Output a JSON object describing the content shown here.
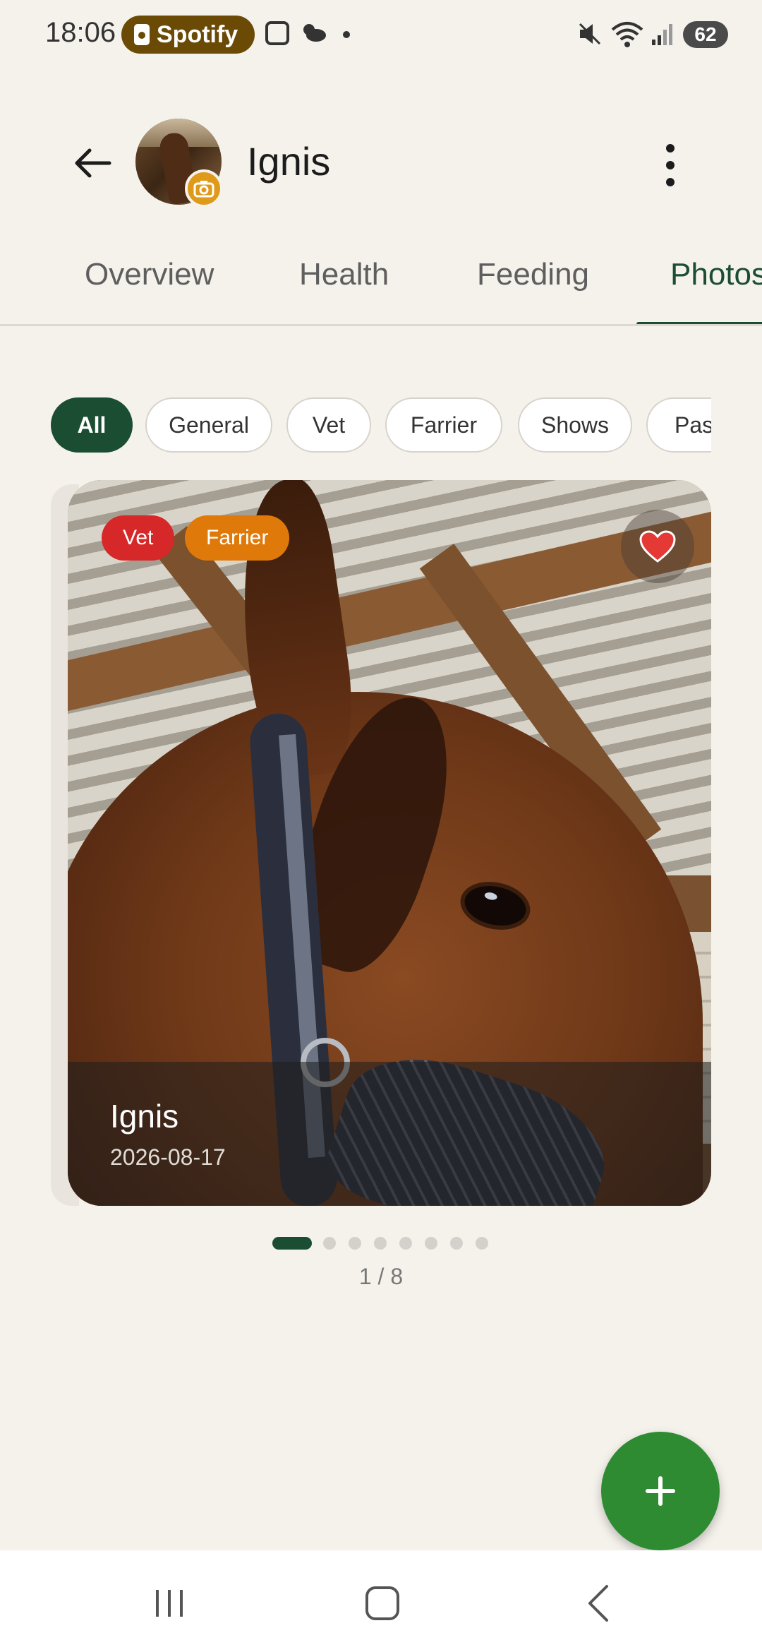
{
  "status_bar": {
    "time": "18:06",
    "media_app": "Spotify",
    "battery": "62",
    "icons": [
      "screenshot-icon",
      "weather-icon",
      "notification-dot-icon",
      "mute-icon",
      "wifi-icon",
      "signal-icon"
    ]
  },
  "header": {
    "title": "Ignis",
    "back_icon": "arrow-left-icon",
    "avatar_badge_icon": "camera-icon",
    "menu_icon": "more-vertical-icon"
  },
  "tabs": [
    {
      "label": "Overview",
      "active": false
    },
    {
      "label": "Health",
      "active": false
    },
    {
      "label": "Feeding",
      "active": false
    },
    {
      "label": "Photos",
      "active": true
    }
  ],
  "filters": [
    {
      "label": "All",
      "selected": true
    },
    {
      "label": "General",
      "selected": false
    },
    {
      "label": "Vet",
      "selected": false
    },
    {
      "label": "Farrier",
      "selected": false
    },
    {
      "label": "Shows",
      "selected": false
    },
    {
      "label": "Past",
      "selected": false
    }
  ],
  "photo": {
    "name": "Ignis",
    "date": "2026-08-17",
    "tags": [
      "Vet",
      "Farrier"
    ],
    "favorite": true
  },
  "pager": {
    "current": 1,
    "total": 8,
    "label": "1 / 8"
  },
  "fab": {
    "icon": "plus-icon"
  },
  "colors": {
    "background": "#f5f2ec",
    "primary": "#1b4d33",
    "fab": "#2e8b32",
    "tag_vet": "#d62828",
    "tag_farrier": "#df7a0a",
    "favorite": "#e53935"
  }
}
